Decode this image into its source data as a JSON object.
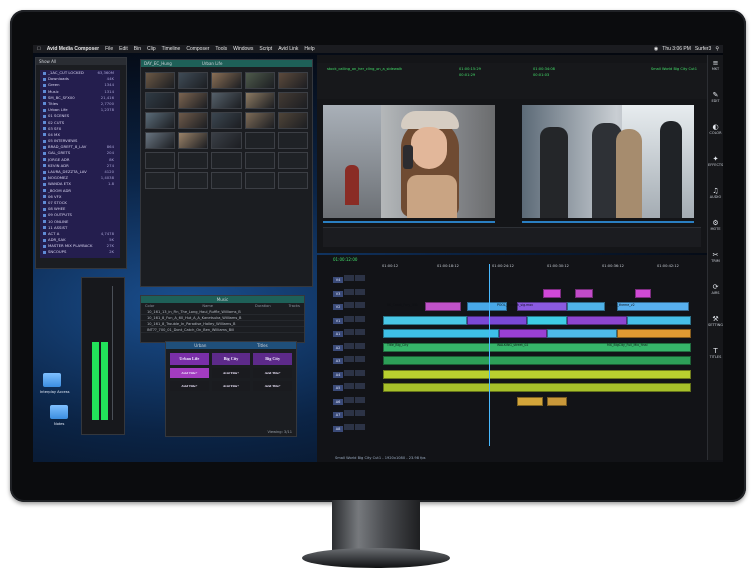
{
  "menubar": {
    "app": "Avid Media Composer",
    "items": [
      "File",
      "Edit",
      "Bin",
      "Clip",
      "Timeline",
      "Composer",
      "Tools",
      "Windows",
      "Script",
      "Avid Link",
      "Help"
    ],
    "clock": "Thu 3:06 PM",
    "user": "Surfer3"
  },
  "bins": {
    "header": "Show All",
    "rows": [
      {
        "label": "_1AC_CUT LOCKED",
        "value": "63,360M"
      },
      {
        "label": "Downloads",
        "value": "44K"
      },
      {
        "label": "Green",
        "value": "1344"
      },
      {
        "label": "Music",
        "value": "1314"
      },
      {
        "label": "SM_BC_SFX00",
        "value": "21,416"
      },
      {
        "label": "Titles",
        "value": "2,7700"
      },
      {
        "label": "Urban Life",
        "value": "1,2378"
      },
      {
        "label": "01 SCENES",
        "value": ""
      },
      {
        "label": "02 CUTS",
        "value": ""
      },
      {
        "label": "03 SFX",
        "value": ""
      },
      {
        "label": "04 MX",
        "value": ""
      },
      {
        "label": "05 INTERVIEWS",
        "value": ""
      },
      {
        "label": "BRAD_GREFT_8_LAV",
        "value": "864"
      },
      {
        "label": "GAL_GRETS",
        "value": "204"
      },
      {
        "label": "JORGE ADR",
        "value": "8K"
      },
      {
        "label": "KEVIN ADR",
        "value": "274"
      },
      {
        "label": "LAURA_DEZZTA_LAV",
        "value": "4120"
      },
      {
        "label": "NOGOMEZ",
        "value": "1,4038"
      },
      {
        "label": "WANDA ETX",
        "value": "1.8"
      },
      {
        "label": "_BOOM ADR",
        "value": ""
      },
      {
        "label": "06 VFX",
        "value": ""
      },
      {
        "label": "07 STOCK",
        "value": ""
      },
      {
        "label": "08 WHEE",
        "value": ""
      },
      {
        "label": "09 OUTPUTS",
        "value": ""
      },
      {
        "label": "10 ONLINE",
        "value": ""
      },
      {
        "label": "11 ASSIST",
        "value": ""
      },
      {
        "label": "ACT A",
        "value": "4,7478"
      },
      {
        "label": "ADR_SAK",
        "value": "5K"
      },
      {
        "label": "MASTER MIX PLAYBACK",
        "value": "27K"
      },
      {
        "label": "SNCOUPS",
        "value": "2K"
      }
    ]
  },
  "clips_panel": {
    "tab1": "DAY_EC_Hung",
    "tab2": "Urban Life"
  },
  "music_panel": {
    "title": "Music",
    "columns": [
      "Color",
      "Name",
      "Duration",
      "Tracks"
    ],
    "rows": [
      "10_161_13_in_Fin_The_Long_Haul_Ruffle_Williams_B",
      "10_161_8_Fun_A_60_Hut_A_A_Kanetsuka_Williams_B",
      "10_161_8_Trouble_In_Paradise_Halley_Williams_B",
      "INT??_700_01_Dont_Catch_On_Ben_Williams_Bill"
    ],
    "footer": "Viewing: 16/102"
  },
  "titles_panel": {
    "tab1": "Urban",
    "tab2": "Titles",
    "cards": [
      "Urban Life",
      "Big City",
      "Big City",
      "Avid Title+",
      "Avid Title+",
      "Avid Title+",
      "Avid Title+",
      "Avid Title+",
      "Avid Title+"
    ],
    "footer": "Viewing: 3/11"
  },
  "source_monitor": {
    "clip_name": "stock_calling_on_her_cling_on_a_sidewalk",
    "tc1": "01:00:15:29",
    "tc2": "00:01:29"
  },
  "record_monitor": {
    "sequence_name": "Small World Big City Cut1",
    "tc1": "01:00:34:08",
    "tc2": "00:01:03"
  },
  "timeline": {
    "timecode": "01:00:12:00",
    "ruler": [
      "01:00:12",
      "01:00:18:12",
      "01:00:24:12",
      "01:00:30:12",
      "01:00:36:12",
      "01:00:42:12"
    ],
    "tracks": [
      "V4",
      "V3",
      "V2",
      "V1",
      "A1",
      "A2",
      "A3",
      "A4",
      "A5",
      "A6",
      "A7",
      "A8"
    ],
    "footer": "Small World Big City Cut1 - 1920x1080 - 23.98 fps",
    "clip_labels": [
      "8K_Coast_Fury_001",
      "POOL_woman_sig.mov",
      "MUSIC_theme_v2",
      "Title_Big_City",
      "WALKING_street_02",
      "MX_BigCity_Full_Mix_final"
    ]
  },
  "tools": [
    "MKT",
    "EDIT",
    "COLOR",
    "EFFECTS",
    "AUDIO",
    "MOTE",
    "TRIM",
    "AIRS",
    "SETTINGS",
    "TITLES"
  ],
  "desktop": {
    "icon1": "Interplay Access",
    "icon2": "Notes"
  }
}
